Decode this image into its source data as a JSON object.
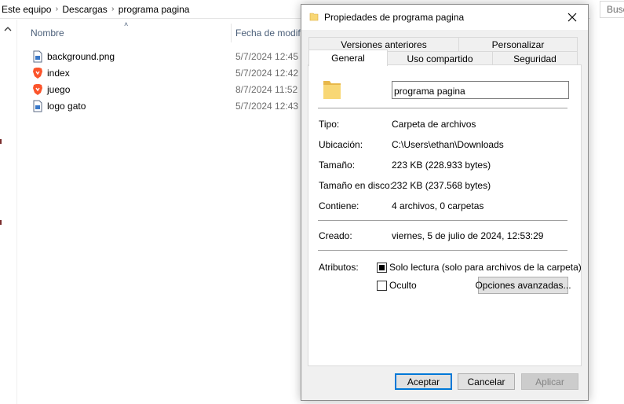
{
  "explorer": {
    "breadcrumbs": [
      "Este equipo",
      "Descargas",
      "programa pagina"
    ],
    "search_placeholder": "Buscar",
    "columns": {
      "name": "Nombre",
      "date": "Fecha de modificación"
    },
    "files": [
      {
        "name": "background.png",
        "date": "5/7/2024 12:45",
        "icon": "image-file-icon"
      },
      {
        "name": "index",
        "date": "5/7/2024 12:42",
        "icon": "brave-browser-icon"
      },
      {
        "name": "juego",
        "date": "8/7/2024 11:52",
        "icon": "brave-browser-icon"
      },
      {
        "name": "logo gato",
        "date": "5/7/2024 12:43",
        "icon": "image-file-icon"
      }
    ]
  },
  "dialog": {
    "title": "Propiedades de programa pagina",
    "tabs_top": [
      "Versiones anteriores",
      "Personalizar"
    ],
    "tabs_bottom": [
      "General",
      "Uso compartido",
      "Seguridad"
    ],
    "active_tab": "General",
    "folder_name": "programa pagina",
    "properties": [
      {
        "label": "Tipo:",
        "value": "Carpeta de archivos"
      },
      {
        "label": "Ubicación:",
        "value": "C:\\Users\\ethan\\Downloads"
      },
      {
        "label": "Tamaño:",
        "value": "223 KB (228.933 bytes)"
      },
      {
        "label": "Tamaño en disco:",
        "value": "232 KB (237.568 bytes)"
      },
      {
        "label": "Contiene:",
        "value": "4 archivos, 0 carpetas"
      }
    ],
    "created": {
      "label": "Creado:",
      "value": "viernes, 5 de julio de 2024, 12:53:29"
    },
    "attributes": {
      "label": "Atributos:",
      "readonly_label": "Solo lectura (solo para archivos de la carpeta)",
      "readonly_state": "indeterminate",
      "hidden_label": "Oculto",
      "hidden_checked": false,
      "advanced_button": "Opciones avanzadas..."
    },
    "buttons": {
      "ok": "Aceptar",
      "cancel": "Cancelar",
      "apply": "Aplicar"
    },
    "colors": {
      "accent": "#0078d7",
      "folder": "#f8d775"
    }
  }
}
